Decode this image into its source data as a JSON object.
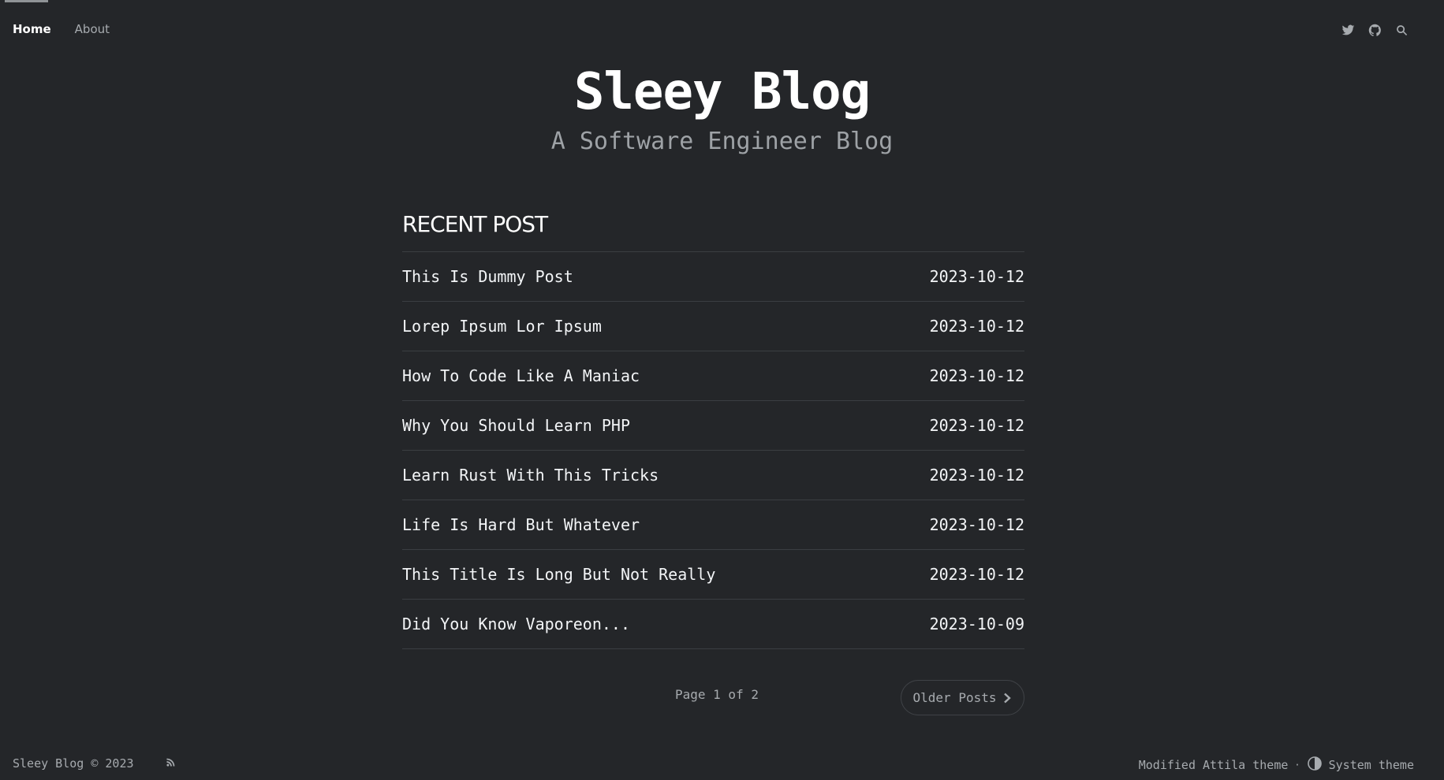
{
  "nav": {
    "home": "Home",
    "about": "About",
    "icons": [
      "twitter-icon",
      "github-icon",
      "search-icon"
    ]
  },
  "header": {
    "title": "Sleey Blog",
    "subtitle": "A Software Engineer Blog"
  },
  "posts": {
    "section_title": "RECENT POST",
    "items": [
      {
        "title": "This Is Dummy Post",
        "date": "2023-10-12"
      },
      {
        "title": "Lorep Ipsum Lor Ipsum",
        "date": "2023-10-12"
      },
      {
        "title": "How To Code Like A Maniac",
        "date": "2023-10-12"
      },
      {
        "title": "Why You Should Learn PHP",
        "date": "2023-10-12"
      },
      {
        "title": "Learn Rust With This Tricks",
        "date": "2023-10-12"
      },
      {
        "title": "Life Is Hard But Whatever",
        "date": "2023-10-12"
      },
      {
        "title": "This Title Is Long But Not Really",
        "date": "2023-10-12"
      },
      {
        "title": "Did You Know Vaporeon...",
        "date": "2023-10-09"
      }
    ]
  },
  "pagination": {
    "page_info": "Page 1 of 2",
    "older_label": "Older Posts"
  },
  "footer": {
    "copyright": "Sleey Blog © 2023",
    "theme_credit": "Modified Attila theme",
    "separator": "·",
    "theme_toggle": "System theme"
  },
  "colors": {
    "background": "#242629",
    "text": "#ffffff",
    "muted": "#a7abaf",
    "divider": "#3b3e42"
  }
}
